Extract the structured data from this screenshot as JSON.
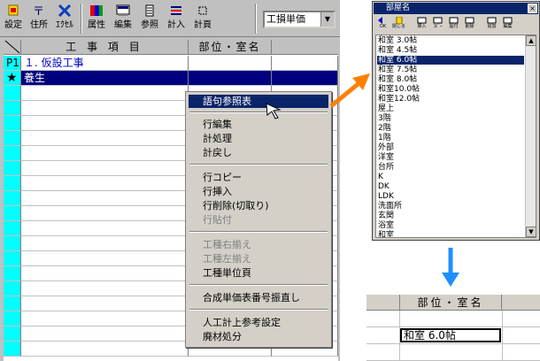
{
  "toolbar": {
    "buttons": [
      {
        "label": "設定",
        "icon": "settings-icon"
      },
      {
        "label": "住所",
        "icon": "address-icon"
      },
      {
        "label": "ｴｸｾﾙ",
        "icon": "excel-icon"
      },
      {
        "label": "属性",
        "icon": "attribute-icon"
      },
      {
        "label": "編集",
        "icon": "edit-icon"
      },
      {
        "label": "参照",
        "icon": "reference-icon"
      },
      {
        "label": "計入",
        "icon": "calc-in-icon"
      },
      {
        "label": "計頁",
        "icon": "calc-page-icon"
      }
    ],
    "combo_value": "工損単価"
  },
  "grid": {
    "headers": [
      "工 事 項 目",
      "部位・室名"
    ],
    "rows": [
      {
        "head": "P1",
        "item": "１. 仮設工事",
        "room": ""
      },
      {
        "head": "★",
        "item": "養生",
        "room": ""
      }
    ]
  },
  "context_menu": {
    "items": [
      {
        "label": "語句参照表",
        "state": "highlighted"
      },
      {
        "label": "行編集",
        "state": "enabled"
      },
      {
        "label": "計処理",
        "state": "enabled"
      },
      {
        "label": "計戻し",
        "state": "enabled"
      },
      {
        "label": "行コピー",
        "state": "enabled"
      },
      {
        "label": "行挿入",
        "state": "enabled"
      },
      {
        "label": "行削除(切取り)",
        "state": "enabled"
      },
      {
        "label": "行貼付",
        "state": "disabled"
      },
      {
        "label": "工種右揃え",
        "state": "disabled"
      },
      {
        "label": "工種左揃え",
        "state": "disabled"
      },
      {
        "label": "工種単位頁",
        "state": "enabled"
      },
      {
        "label": "合成単価表番号振直し",
        "state": "enabled"
      },
      {
        "label": "人工計上参考設定",
        "state": "enabled"
      },
      {
        "label": "廃材処分",
        "state": "enabled"
      }
    ]
  },
  "popup": {
    "title": "部屋名",
    "close_label": "×",
    "toolbar": [
      "OK",
      "閉じる",
      "挿入",
      "ｺﾋﾟｰ",
      "貼付",
      "削除",
      "追加",
      "編集"
    ],
    "list": [
      "和室 3.0帖",
      "和室 4.5帖",
      "和室 6.0帖",
      "和室 7.5帖",
      "和室 8.0帖",
      "和室10.0帖",
      "和室12.0帖",
      "屋上",
      "3階",
      "2階",
      "1階",
      "外部",
      "洋室",
      "台所",
      "K",
      "DK",
      "LDK",
      "洗面所",
      "玄関",
      "浴室",
      "和室"
    ],
    "selected": "和室 6.0帖"
  },
  "result": {
    "header": "部位・室名",
    "value": "和室 6.0帖"
  },
  "colors": {
    "selection": "#000080",
    "row_header": "#00ffff",
    "arrow": "#ff8000",
    "down_arrow": "#1e90ff"
  }
}
